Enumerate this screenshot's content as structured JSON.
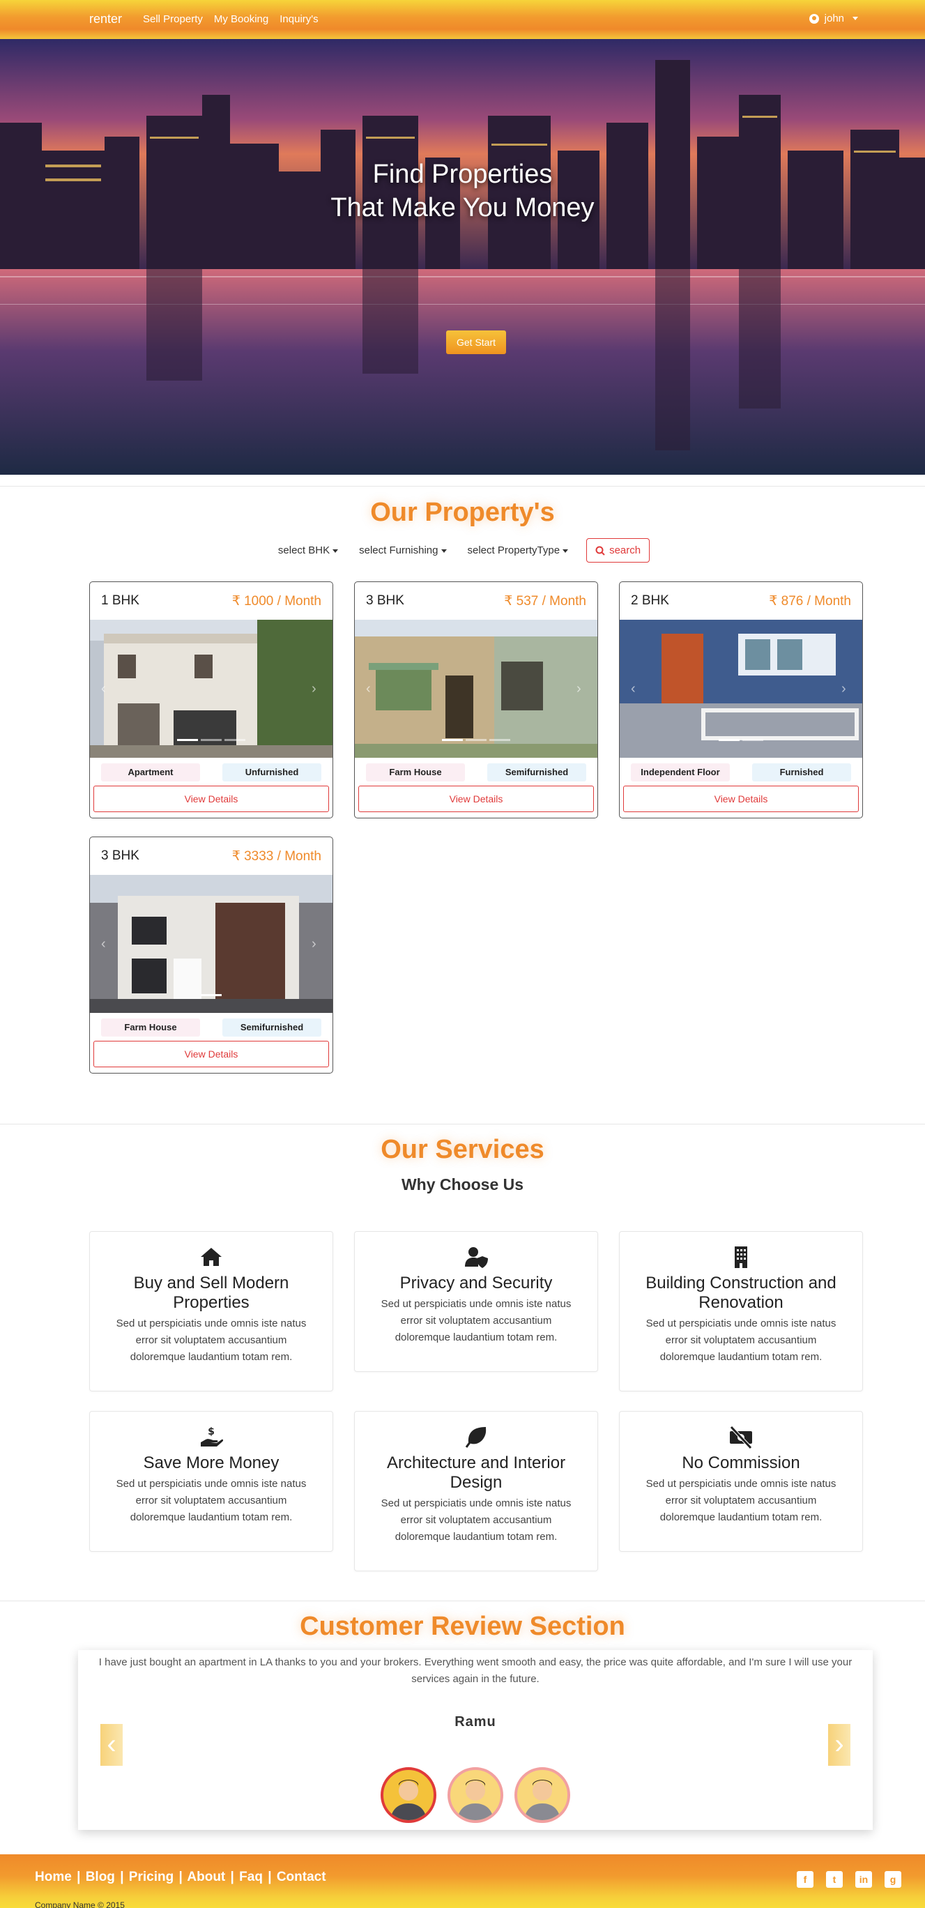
{
  "navbar": {
    "brand": "renter",
    "links": [
      "Sell Property",
      "My Booking",
      "Inquiry's"
    ],
    "user": "john"
  },
  "hero": {
    "title_line1": "Find Properties",
    "title_line2": "That Make You Money",
    "button": "Get Start"
  },
  "properties": {
    "heading": "Our Property's",
    "filters": [
      "select BHK",
      "select Furnishing",
      "select PropertyType"
    ],
    "search_label": "search",
    "cards": [
      {
        "bhk": "1 BHK",
        "price": "₹ 1000 / Month",
        "type": "Apartment",
        "furnishing": "Unfurnished",
        "button": "View Details"
      },
      {
        "bhk": "3 BHK",
        "price": "₹ 537 / Month",
        "type": "Farm House",
        "furnishing": "Semifurnished",
        "button": "View Details"
      },
      {
        "bhk": "2 BHK",
        "price": "₹ 876 / Month",
        "type": "Independent Floor",
        "furnishing": "Furnished",
        "button": "View Details"
      },
      {
        "bhk": "3 BHK",
        "price": "₹ 3333 / Month",
        "type": "Farm House",
        "furnishing": "Semifurnished",
        "button": "View Details"
      }
    ]
  },
  "services": {
    "heading": "Our Services",
    "subheading": "Why Choose Us",
    "items": [
      {
        "icon": "home-icon",
        "title": "Buy and Sell Modern Properties",
        "text": "Sed ut perspiciatis unde omnis iste natus error sit voluptatem accusantium doloremque laudantium totam rem."
      },
      {
        "icon": "user-shield-icon",
        "title": "Privacy and Security",
        "text": "Sed ut perspiciatis unde omnis iste natus error sit voluptatem accusantium doloremque laudantium totam rem."
      },
      {
        "icon": "building-icon",
        "title": "Building Construction and Renovation",
        "text": "Sed ut perspiciatis unde omnis iste natus error sit voluptatem accusantium doloremque laudantium totam rem."
      },
      {
        "icon": "hand-dollar-icon",
        "title": "Save More Money",
        "text": "Sed ut perspiciatis unde omnis iste natus error sit voluptatem accusantium doloremque laudantium totam rem."
      },
      {
        "icon": "leaf-icon",
        "title": "Architecture and Interior Design",
        "text": "Sed ut perspiciatis unde omnis iste natus error sit voluptatem accusantium doloremque laudantium totam rem."
      },
      {
        "icon": "no-money-icon",
        "title": "No Commission",
        "text": "Sed ut perspiciatis unde omnis iste natus error sit voluptatem accusantium doloremque laudantium totam rem."
      }
    ]
  },
  "reviews": {
    "heading": "Customer Review Section",
    "text": "I have just bought an apartment in LA thanks to you and your brokers. Everything went smooth and easy, the price was quite affordable, and I'm sure I will use your services again in the future.",
    "name": "Ramu",
    "prev": "‹",
    "next": "›"
  },
  "footer": {
    "links": [
      "Home",
      "Blog",
      "Pricing",
      "About",
      "Faq",
      "Contact"
    ],
    "separator": "|",
    "copyright": "Company Name © 2015",
    "socials": [
      "facebook-icon",
      "twitter-icon",
      "linkedin-icon",
      "github-icon"
    ]
  },
  "colors": {
    "accent": "#ef8a2a",
    "danger": "#e03a3a"
  }
}
